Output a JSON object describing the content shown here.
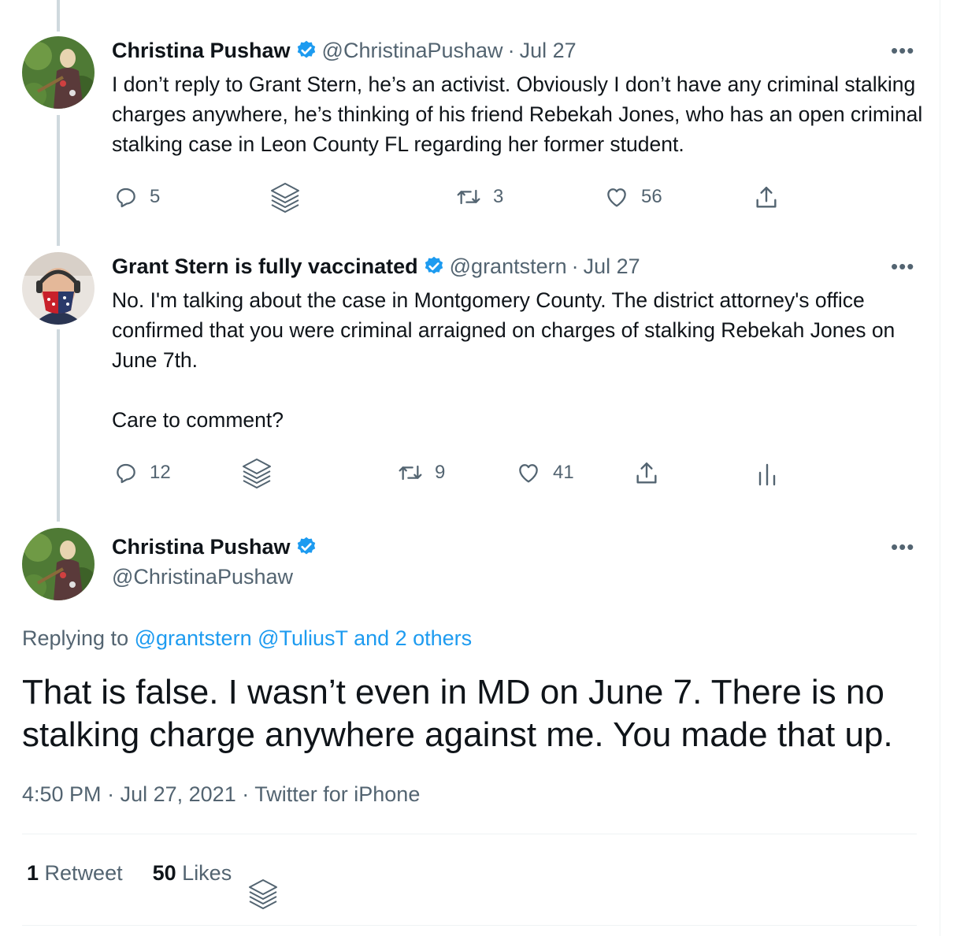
{
  "tweet1": {
    "name": "Christina Pushaw",
    "handle": "@ChristinaPushaw",
    "sep": "·",
    "date": "Jul 27",
    "text": "I don’t reply to Grant Stern, he’s an activist. Obviously I don’t have any criminal stalking charges anywhere, he’s thinking of his friend Rebekah Jones, who has an open criminal stalking case in Leon County FL regarding her former student.",
    "replies": "5",
    "retweets": "3",
    "likes": "56"
  },
  "tweet2": {
    "name": "Grant Stern is fully vaccinated",
    "handle": "@grantstern",
    "sep": "·",
    "date": "Jul 27",
    "text_p1": "No. I'm talking about the case in Montgomery County. The district attorney's office confirmed that you were criminal arraigned on charges of stalking Rebekah Jones on June 7th.",
    "text_p2": "Care to comment?",
    "replies": "12",
    "retweets": "9",
    "likes": "41"
  },
  "main_tweet": {
    "name": "Christina Pushaw",
    "handle": "@ChristinaPushaw",
    "replying_prefix": "Replying to",
    "replying_users": [
      "@grantstern",
      "@TuliusT",
      "and 2 others"
    ],
    "text": "That is false. I wasn’t even in MD on June 7. There is no stalking charge anywhere against me. You made that up.",
    "time": "4:50 PM",
    "date": "Jul 27, 2021",
    "source": "Twitter for iPhone",
    "retweet_count": "1",
    "retweet_label": "Retweet",
    "like_count": "50",
    "like_label": "Likes"
  },
  "icons": {
    "more": "more-horizontal-icon",
    "verified": "verified-badge-icon",
    "reply": "reply-icon",
    "stack": "layers-icon",
    "retweet": "retweet-icon",
    "like": "heart-icon",
    "share": "share-icon",
    "analytics": "analytics-icon"
  },
  "colors": {
    "accent": "#1d9bf0",
    "text": "#0f1419",
    "muted": "#536471",
    "thread_line": "#cfd9de"
  }
}
